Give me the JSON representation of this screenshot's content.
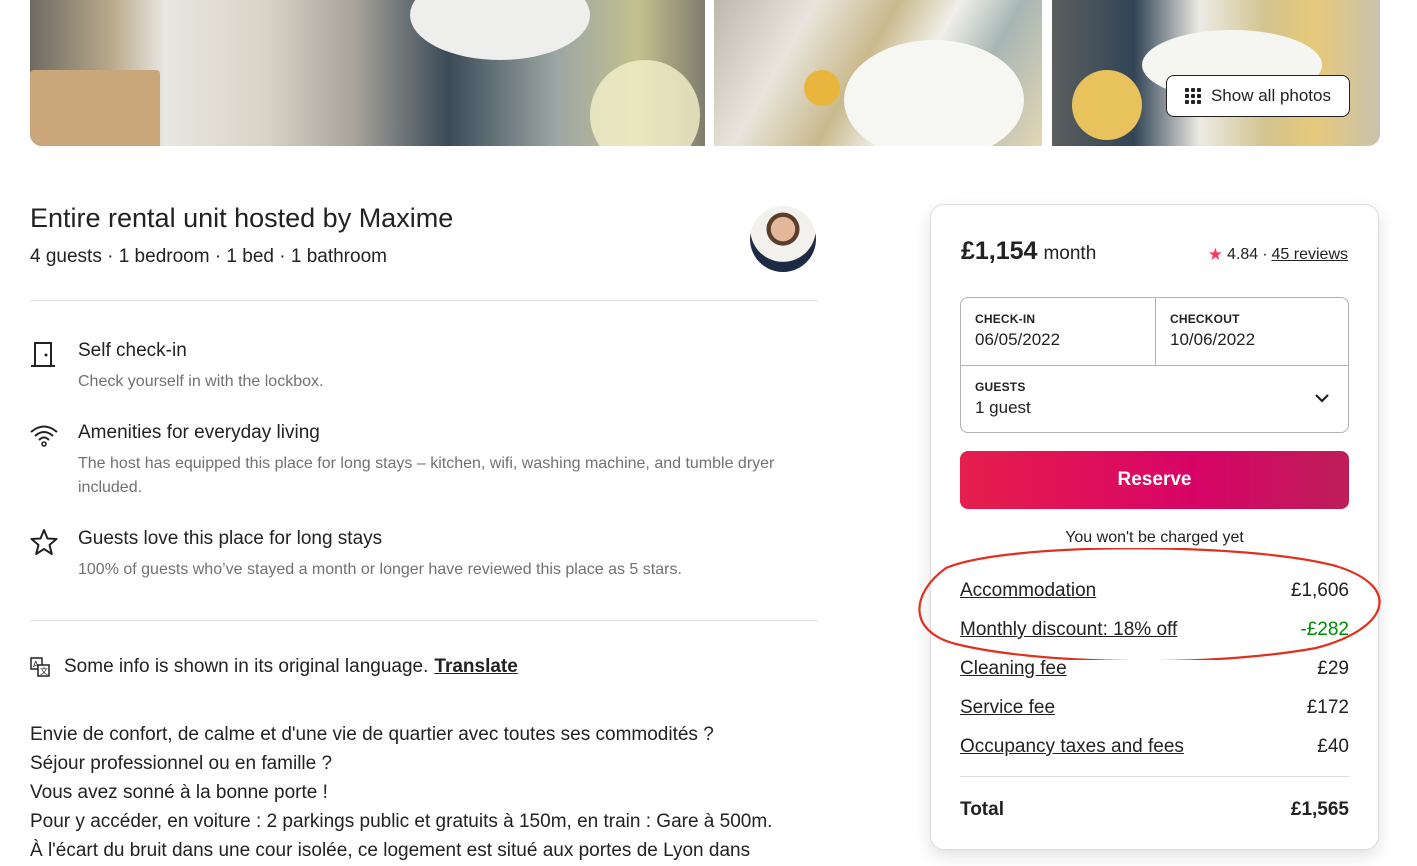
{
  "photos": {
    "show_all_label": "Show all photos"
  },
  "listing": {
    "title": "Entire rental unit hosted by Maxime",
    "subtitle": "4 guests · 1 bedroom · 1 bed · 1 bathroom"
  },
  "features": [
    {
      "icon": "door-icon",
      "title": "Self check-in",
      "description": "Check yourself in with the lockbox."
    },
    {
      "icon": "wifi-icon",
      "title": "Amenities for everyday living",
      "description": "The host has equipped this place for long stays – kitchen, wifi, washing machine, and tumble dryer included."
    },
    {
      "icon": "star-outline-icon",
      "title": "Guests love this place for long stays",
      "description": "100% of guests who’ve stayed a month or longer have reviewed this place as 5 stars."
    }
  ],
  "translate": {
    "notice": "Some info is shown in its original language.",
    "link": "Translate"
  },
  "description_lines": [
    "Envie de confort, de calme et d'une vie de quartier avec toutes ses commodités ?",
    "Séjour professionnel ou en famille ?",
    "Vous avez sonné à la bonne porte !",
    "Pour y accéder, en voiture : 2 parkings public et gratuits à 150m, en train : Gare à 500m.",
    "À l'écart du bruit dans une cour isolée, ce logement est situé aux portes de Lyon dans"
  ],
  "booking": {
    "price": "£1,154",
    "price_unit": "month",
    "rating": "4.84",
    "separator": "·",
    "reviews": "45 reviews",
    "checkin_label": "CHECK-IN",
    "checkin_value": "06/05/2022",
    "checkout_label": "CHECKOUT",
    "checkout_value": "10/06/2022",
    "guests_label": "GUESTS",
    "guests_value": "1 guest",
    "reserve_label": "Reserve",
    "no_charge_note": "You won't be charged yet",
    "fees": [
      {
        "label": "Accommodation",
        "value": "£1,606",
        "color": "#222222"
      },
      {
        "label": "Monthly discount: 18% off",
        "value": "-£282",
        "color": "#008a05"
      },
      {
        "label": "Cleaning fee",
        "value": "£29",
        "color": "#222222"
      },
      {
        "label": "Service fee",
        "value": "£172",
        "color": "#222222"
      },
      {
        "label": "Occupancy taxes and fees",
        "value": "£40",
        "color": "#222222"
      }
    ],
    "total_label": "Total",
    "total_value": "£1,565"
  },
  "colors": {
    "brand": "#ff385c",
    "reserve_gradient_start": "#e61e4d",
    "reserve_gradient_end": "#bd1e59",
    "discount_green": "#008a05",
    "annotation_red": "#e0301e"
  }
}
